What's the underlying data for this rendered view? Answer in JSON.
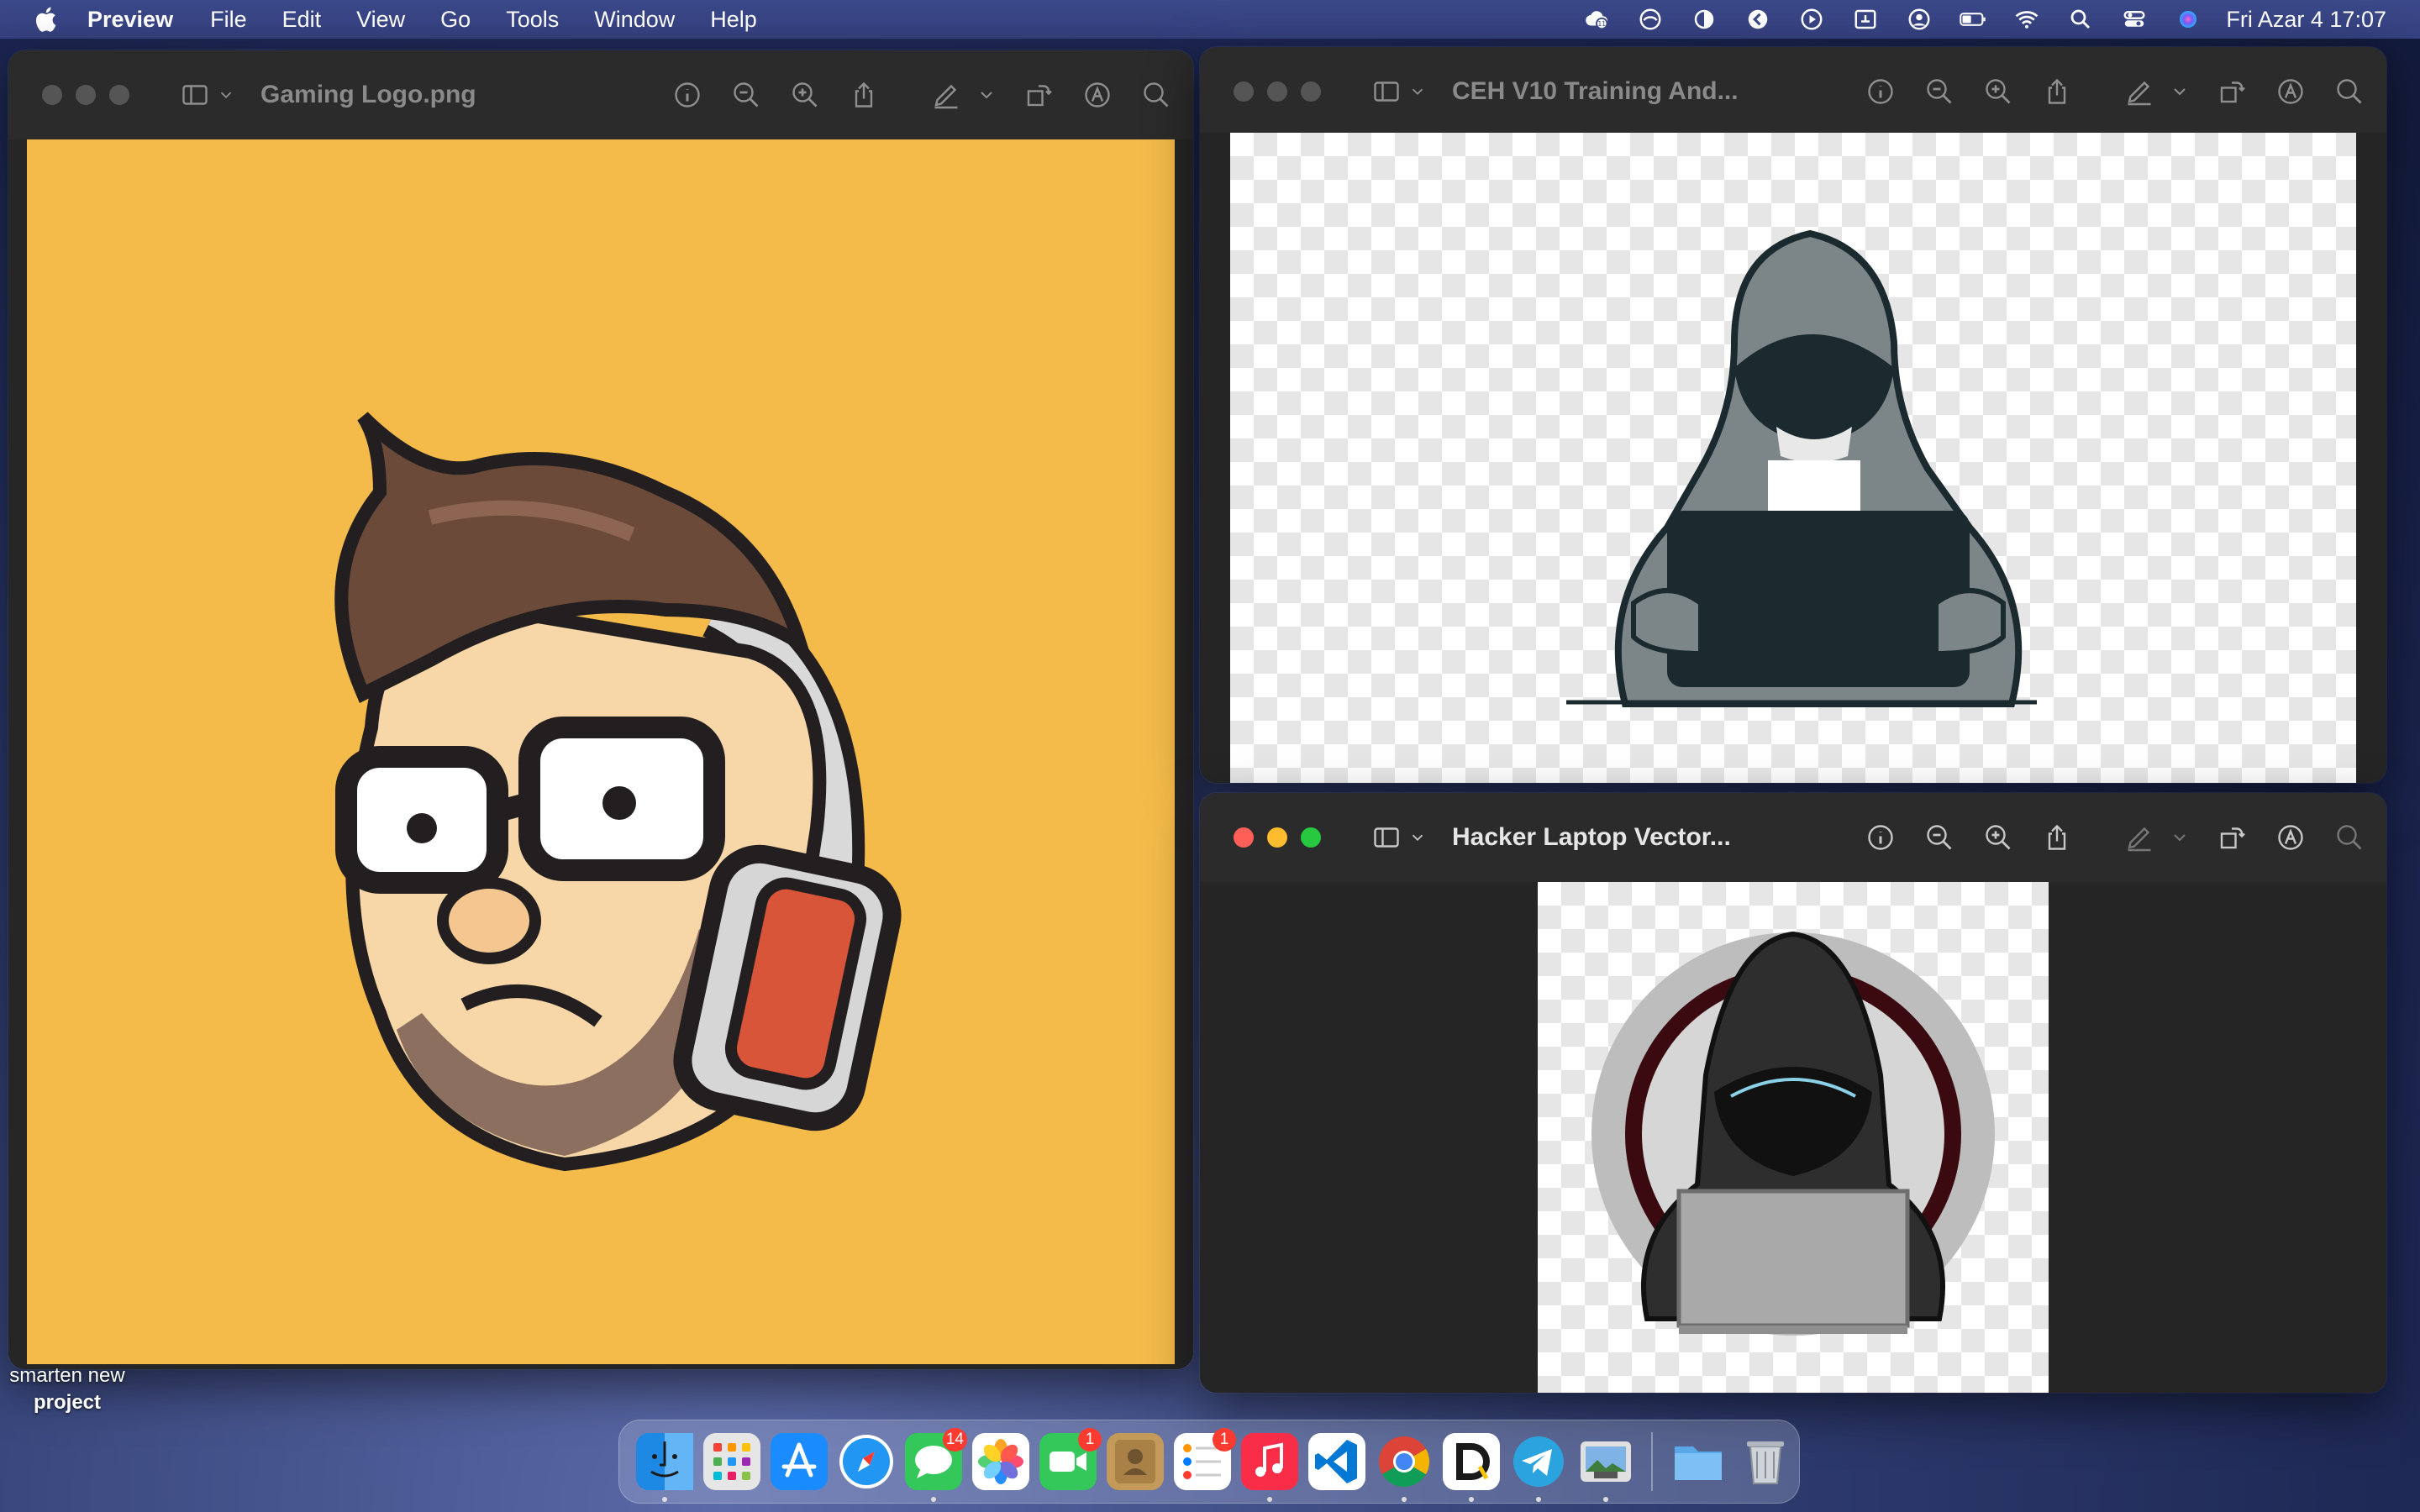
{
  "menubar": {
    "app_name": "Preview",
    "items": [
      "File",
      "Edit",
      "View",
      "Go",
      "Tools",
      "Window",
      "Help"
    ],
    "status_icons": [
      "creative-cloud-icon",
      "cloud-sync-icon",
      "contrast-icon",
      "arrow-circle-icon",
      "play-circle-icon",
      "screen-text-icon",
      "user-circle-icon",
      "battery-icon",
      "wifi-icon",
      "spotlight-icon",
      "control-center-icon",
      "siri-icon"
    ],
    "clock": "Fri Azar 4  17:07"
  },
  "windows": [
    {
      "id": "gaming-logo",
      "title": "Gaming Logo.png",
      "active": false,
      "content_bg": "#f4bb4a"
    },
    {
      "id": "ceh-training",
      "title": "CEH V10 Training And...",
      "active": false
    },
    {
      "id": "hacker-laptop",
      "title": "Hacker Laptop Vector...",
      "active": true
    }
  ],
  "desktop": {
    "label_line1": "smarten new",
    "label_line2": "project"
  },
  "dock": {
    "apps": [
      {
        "name": "Finder",
        "badge": ""
      },
      {
        "name": "Launchpad",
        "badge": ""
      },
      {
        "name": "App Store",
        "badge": ""
      },
      {
        "name": "Safari",
        "badge": ""
      },
      {
        "name": "Messages",
        "badge": "14"
      },
      {
        "name": "Photos",
        "badge": ""
      },
      {
        "name": "FaceTime",
        "badge": "1"
      },
      {
        "name": "Contacts",
        "badge": ""
      },
      {
        "name": "Reminders",
        "badge": "1"
      },
      {
        "name": "Music",
        "badge": ""
      },
      {
        "name": "Visual Studio Code",
        "badge": ""
      },
      {
        "name": "Google Chrome",
        "badge": ""
      },
      {
        "name": "Dictionary",
        "badge": ""
      },
      {
        "name": "Telegram",
        "badge": ""
      },
      {
        "name": "Preview",
        "badge": ""
      },
      {
        "name": "Downloads",
        "badge": ""
      },
      {
        "name": "Trash",
        "badge": ""
      }
    ]
  }
}
